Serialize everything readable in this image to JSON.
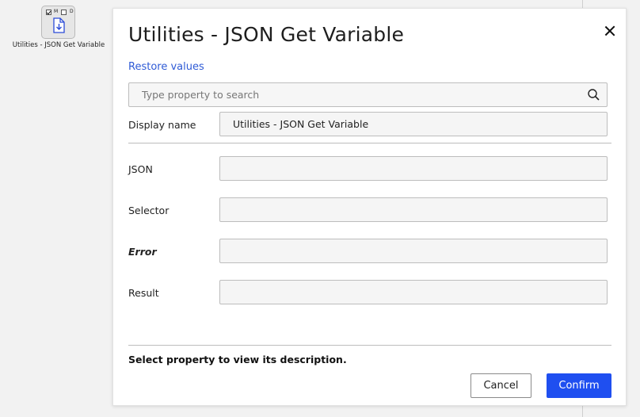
{
  "canvas": {
    "node": {
      "check_m_label": "M",
      "check_d_label": "D",
      "check_m_checked": true,
      "check_d_checked": false,
      "icon": "download-file-icon",
      "label": "Utilities - JSON Get Variable"
    }
  },
  "dialog": {
    "title": "Utilities - JSON Get Variable",
    "close_icon": "close-icon",
    "restore_link": "Restore values",
    "search": {
      "placeholder": "Type property to search",
      "value": "",
      "icon": "search-icon"
    },
    "display_name": {
      "label": "Display name",
      "value": "Utilities - JSON Get Variable"
    },
    "properties": [
      {
        "label": "JSON",
        "value": "",
        "emphasis": false
      },
      {
        "label": "Selector",
        "value": "",
        "emphasis": false
      },
      {
        "label": "Error",
        "value": "",
        "emphasis": true
      },
      {
        "label": "Result",
        "value": "",
        "emphasis": false
      }
    ],
    "description": "Select property to view its description.",
    "cancel_label": "Cancel",
    "confirm_label": "Confirm"
  },
  "colors": {
    "accent": "#1f4ff0",
    "link": "#2f5bd6",
    "field_bg": "#f5f5f5",
    "canvas_bg": "#f2f2f2"
  }
}
